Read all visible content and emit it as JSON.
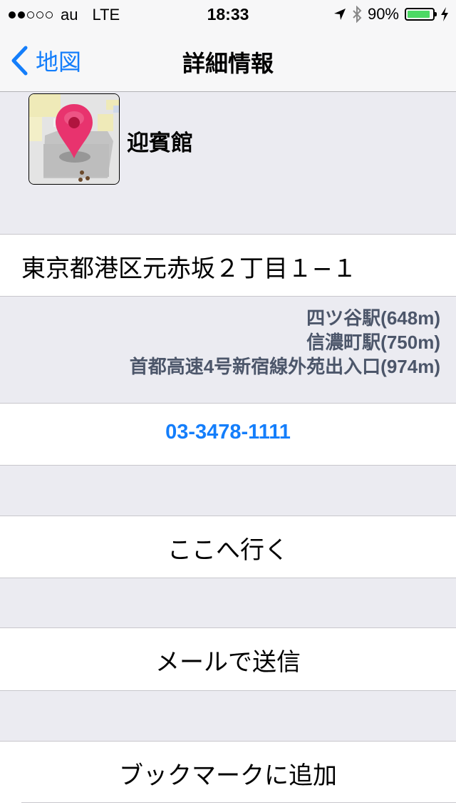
{
  "status_bar": {
    "carrier": "au",
    "network": "LTE",
    "time": "18:33",
    "battery": "90%",
    "battery_level": 0.9,
    "signal_bars_filled": 2,
    "signal_bars_total": 5,
    "icons": [
      "location-arrow-icon",
      "bluetooth-icon",
      "battery-icon",
      "charging-bolt-icon"
    ]
  },
  "nav": {
    "back_label": "地図",
    "title": "詳細情報"
  },
  "place": {
    "name": "迎賓館"
  },
  "address": "東京都港区元赤坂２丁目１−１",
  "nearby": [
    "四ツ谷駅(648m)",
    "信濃町駅(750m)",
    "首都高速4号新宿線外苑出入口(974m)"
  ],
  "phone": "03-3478-1111",
  "actions": {
    "navigate": "ここへ行く",
    "mail": "メールで送信",
    "bookmark": "ブックマークに追加"
  },
  "colors": {
    "accent": "#147efb",
    "background": "#ebebf1",
    "pin": "#e8336e",
    "battery": "#4cd964"
  }
}
